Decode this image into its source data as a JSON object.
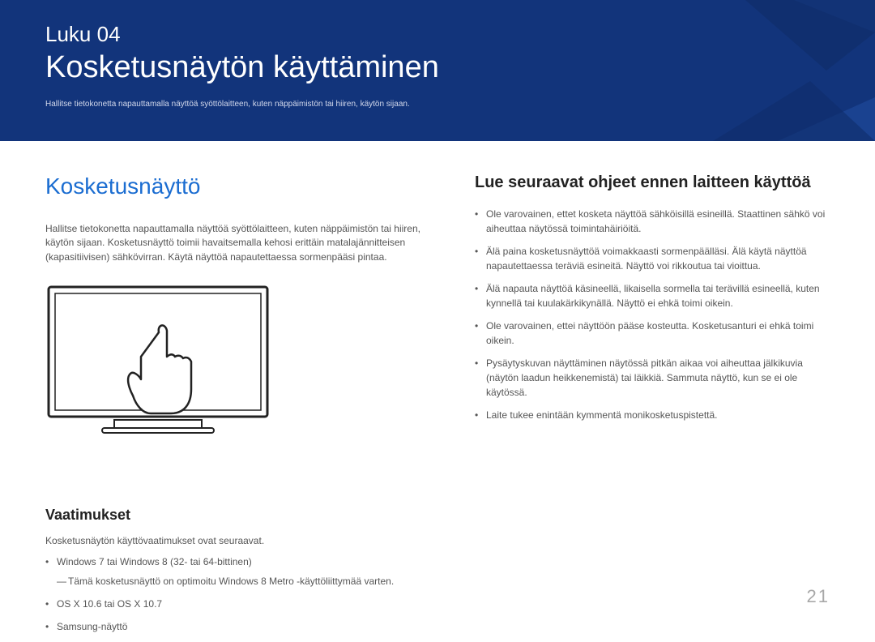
{
  "banner": {
    "chapterLabel": "Luku 04",
    "chapterTitle": "Kosketusnäytön käyttäminen",
    "subtitle": "Hallitse tietokonetta napauttamalla näyttöä syöttölaitteen, kuten näppäimistön tai hiiren, käytön sijaan."
  },
  "left": {
    "sectionTitle": "Kosketusnäyttö",
    "intro": "Hallitse tietokonetta napauttamalla näyttöä syöttölaitteen, kuten näppäimistön tai hiiren, käytön sijaan. Kosketusnäyttö toimii havaitsemalla kehosi erittäin matalajännitteisen (kapasitiivisen) sähkövirran. Käytä näyttöä napautettaessa sormenpääsi pintaa.",
    "reqHeading": "Vaatimukset",
    "reqIntro": "Kosketusnäytön käyttövaatimukset ovat seuraavat.",
    "reqItems": [
      "Windows 7 tai Windows 8 (32- tai 64-bittinen)",
      "OS X 10.6 tai OS X 10.7",
      "Samsung-näyttö"
    ],
    "reqNote": "Tämä kosketusnäyttö on optimoitu Windows 8 Metro -käyttöliittymää varten."
  },
  "right": {
    "heading": "Lue seuraavat ohjeet ennen laitteen käyttöä",
    "items": [
      "Ole varovainen, ettet kosketa näyttöä sähköisillä esineillä. Staattinen sähkö voi aiheuttaa näytössä toimintahäiriöitä.",
      "Älä paina kosketusnäyttöä voimakkaasti sormenpäälläsi. Älä käytä näyttöä napautettaessa teräviä esineitä. Näyttö voi rikkoutua tai vioittua.",
      "Älä napauta näyttöä käsineellä, likaisella sormella tai terävillä esineellä, kuten kynnellä tai kuulakärkikynällä. Näyttö ei ehkä toimi oikein.",
      "Ole varovainen, ettei näyttöön pääse kosteutta. Kosketusanturi ei ehkä toimi oikein.",
      "Pysäytyskuvan näyttäminen näytössä pitkän aikaa voi aiheuttaa jälkikuvia (näytön laadun heikkenemistä) tai läikkiä. Sammuta näyttö, kun se ei ole käytössä.",
      "Laite tukee enintään kymmentä monikosketuspistettä."
    ]
  },
  "pageNumber": "21"
}
